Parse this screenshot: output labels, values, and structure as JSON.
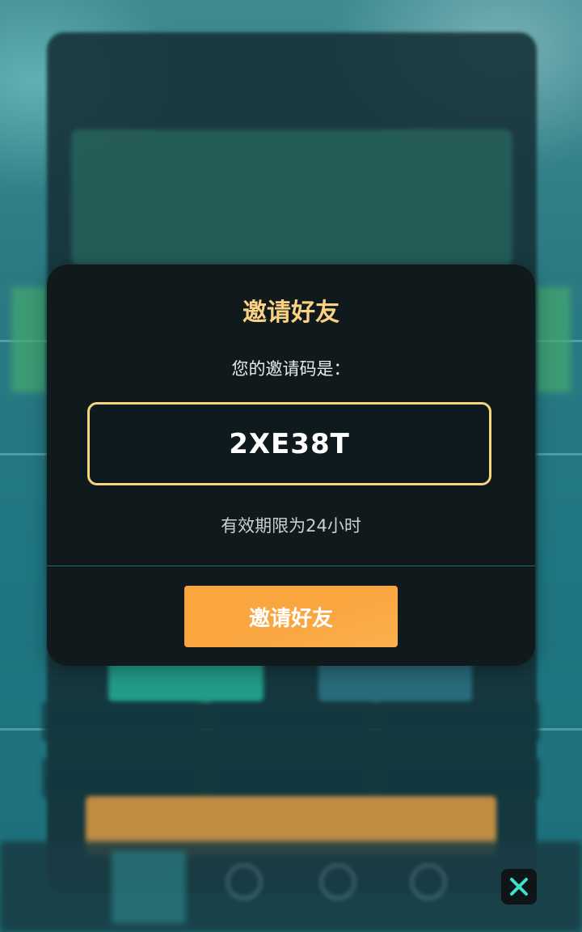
{
  "modal": {
    "title": "邀请好友",
    "subtitle": "您的邀请码是：",
    "invite_code": "2XE38T",
    "validity": "有效期限为24小时",
    "button_label": "邀请好友"
  },
  "close_button": {
    "icon": "close-icon"
  },
  "colors": {
    "title": "#fbd282",
    "code_border": "#f8d57d",
    "button": "#f9a641",
    "close_icon": "#3fe0c8",
    "modal_bg": "#101a1d"
  }
}
